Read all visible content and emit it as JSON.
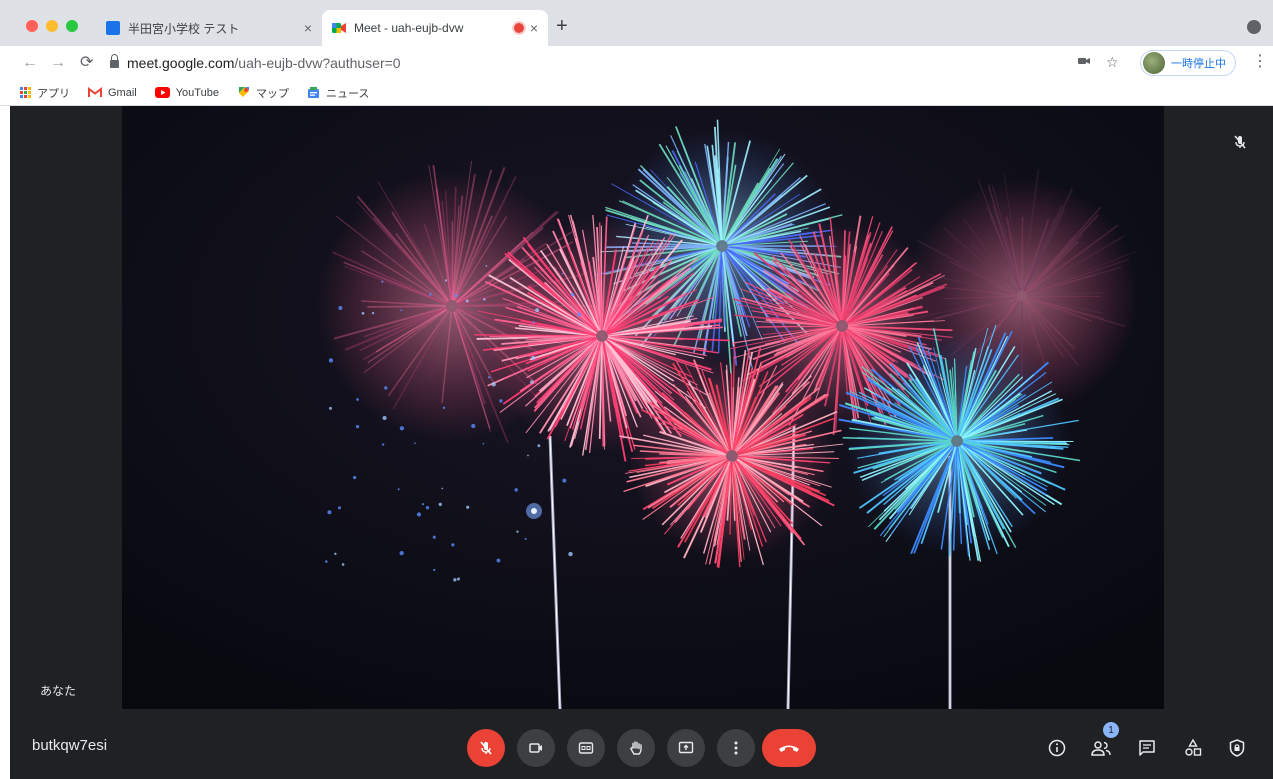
{
  "browser": {
    "tabs": [
      {
        "title": "半田宮小学校 テスト",
        "active": false
      },
      {
        "title": "Meet - uah-eujb-dvw",
        "active": true
      }
    ],
    "new_tab_label": "+",
    "close_glyph": "×",
    "url_host": "meet.google.com",
    "url_path": "/uah-eujb-dvw?authuser=0",
    "pause_label": "一時停止中",
    "bookmarks": [
      {
        "label": "アプリ",
        "icon": "apps-grid-icon"
      },
      {
        "label": "Gmail",
        "icon": "gmail-icon"
      },
      {
        "label": "YouTube",
        "icon": "youtube-icon"
      },
      {
        "label": "マップ",
        "icon": "maps-icon"
      },
      {
        "label": "ニュース",
        "icon": "news-icon"
      }
    ]
  },
  "meet": {
    "self_label": "あなた",
    "meeting_code": "butkqw7esi",
    "participant_count": "1",
    "controls": [
      "mic-off-icon",
      "camera-icon",
      "captions-icon",
      "raise-hand-icon",
      "present-screen-icon",
      "more-options-icon",
      "hang-up-icon"
    ],
    "side_controls": [
      "info-icon",
      "people-icon",
      "chat-icon",
      "activities-icon",
      "host-controls-icon"
    ]
  },
  "colors": {
    "meet_background": "#202124",
    "control_button": "#3c4043",
    "danger": "#ea4335",
    "badge": "#8ab4f8",
    "accent_link": "#1a73e8"
  }
}
